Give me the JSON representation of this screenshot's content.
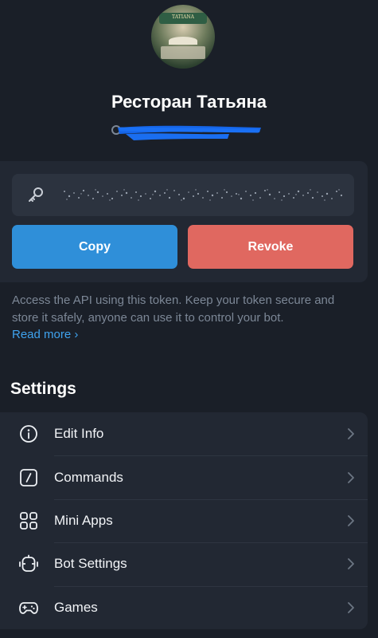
{
  "bot": {
    "name": "Ресторан Татьяна",
    "avatar_sign": "TATIANA"
  },
  "token": {
    "icon": "key-icon",
    "copy_label": "Copy",
    "revoke_label": "Revoke"
  },
  "hint": {
    "text": "Access the API using this token. Keep your token secure and store it safely, anyone can use it to control your bot.",
    "read_more": "Read more ›"
  },
  "settings": {
    "title": "Settings",
    "items": [
      {
        "label": "Edit Info",
        "icon": "info-icon"
      },
      {
        "label": "Commands",
        "icon": "slash-command-icon"
      },
      {
        "label": "Mini Apps",
        "icon": "grid-apps-icon"
      },
      {
        "label": "Bot Settings",
        "icon": "robot-icon"
      },
      {
        "label": "Games",
        "icon": "gamepad-icon"
      }
    ]
  },
  "colors": {
    "background": "#1a1f28",
    "card": "#222833",
    "copy_button": "#2f8fd9",
    "revoke_button": "#e06860",
    "link": "#3fa3ef",
    "muted_text": "#7c8796"
  }
}
